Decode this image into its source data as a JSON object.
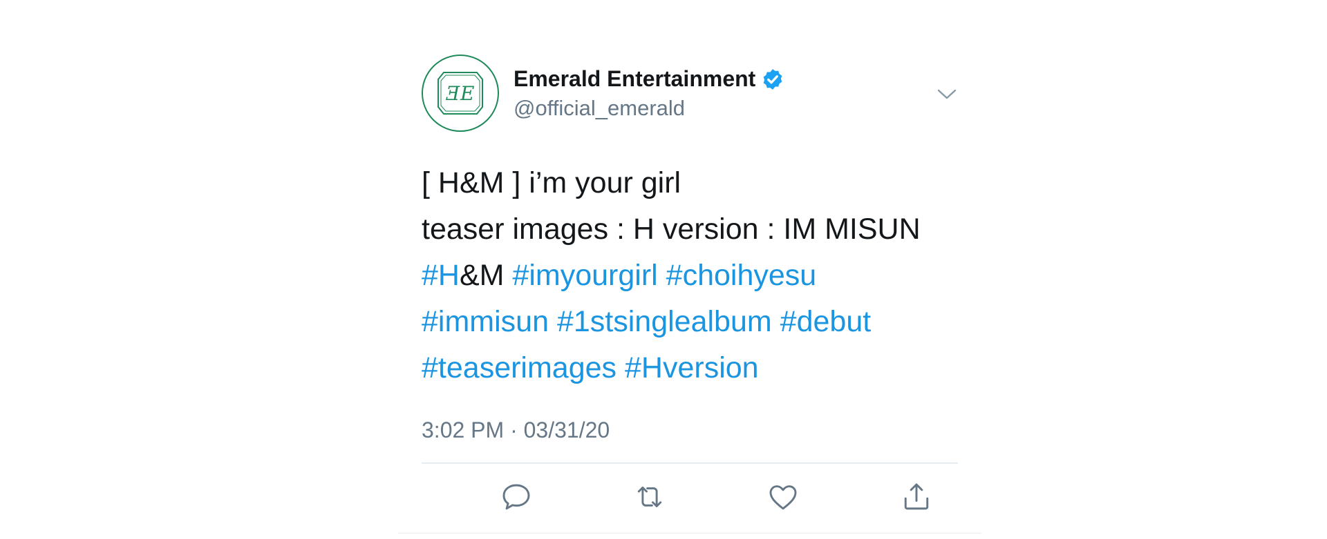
{
  "author": {
    "display_name": "Emerald Entertainment",
    "handle": "@official_emerald",
    "avatar_logo_text": "ƎE",
    "verified": true
  },
  "tweet": {
    "line1": "[ H&M ] i’m your girl",
    "line2": "teaser images : H version : IM MISUN",
    "line3": {
      "tag_h": "#H",
      "tag_h_rest": "&M",
      "tag2": "#imyourgirl",
      "tag3": "#choihyesu"
    },
    "line4": {
      "tag1": "#immisun",
      "tag2": "#1stsinglealbum",
      "tag3": "#debut"
    },
    "line5": {
      "tag1": "#teaserimages",
      "tag2": "#Hversion"
    },
    "timestamp": "3:02 PM · 03/31/20"
  },
  "actions": {
    "reply_icon": "reply-icon",
    "retweet_icon": "retweet-icon",
    "like_icon": "like-icon",
    "share_icon": "share-icon"
  },
  "colors": {
    "link": "#1b95e0",
    "verified": "#1da1f2",
    "secondary_text": "#657786",
    "primary_text": "#14171a",
    "avatar_brand": "#1e8a5a"
  }
}
